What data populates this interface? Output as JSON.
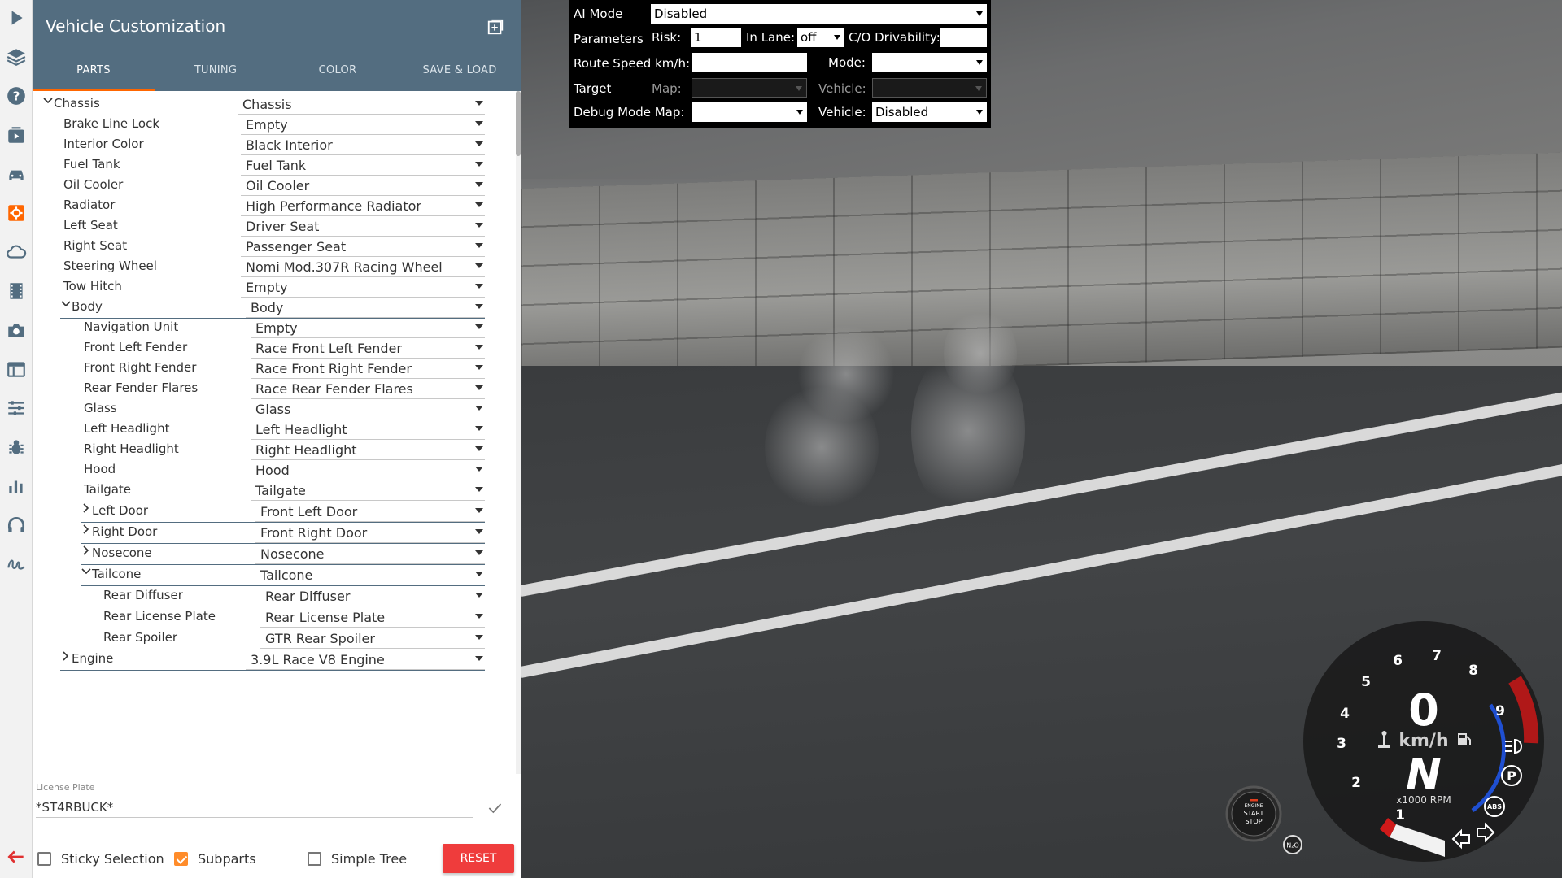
{
  "rail": {
    "icons": [
      "play-icon",
      "layers-icon",
      "help-icon",
      "media-icon",
      "car-icon",
      "gear-active-icon",
      "cloud-icon",
      "film-icon",
      "camera-icon",
      "ui-icon",
      "sliders-icon",
      "bug-icon",
      "chart-icon",
      "headphones-icon",
      "signature-icon"
    ],
    "back_icon": "back-arrow-icon",
    "accent": "#ff6600"
  },
  "panel": {
    "title": "Vehicle Customization",
    "header_color": "#536d80",
    "tabs": [
      {
        "label": "PARTS",
        "active": true
      },
      {
        "label": "TUNING",
        "active": false
      },
      {
        "label": "COLOR",
        "active": false
      },
      {
        "label": "SAVE & LOAD",
        "active": false
      }
    ],
    "tree": [
      {
        "label": "Chassis",
        "value": "Chassis",
        "depth": 0,
        "toggle": "open"
      },
      {
        "label": "Brake Line Lock",
        "value": "Empty",
        "depth": 1
      },
      {
        "label": "Interior Color",
        "value": "Black Interior",
        "depth": 1
      },
      {
        "label": "Fuel Tank",
        "value": "Fuel Tank",
        "depth": 1
      },
      {
        "label": "Oil Cooler",
        "value": "Oil Cooler",
        "depth": 1
      },
      {
        "label": "Radiator",
        "value": "High Performance Radiator",
        "depth": 1
      },
      {
        "label": "Left Seat",
        "value": "Driver Seat",
        "depth": 1
      },
      {
        "label": "Right Seat",
        "value": "Passenger Seat",
        "depth": 1
      },
      {
        "label": "Steering Wheel",
        "value": "Nomi Mod.307R Racing Wheel",
        "depth": 1
      },
      {
        "label": "Tow Hitch",
        "value": "Empty",
        "depth": 1
      },
      {
        "label": "Body",
        "value": "Body",
        "depth": 1,
        "toggle": "open"
      },
      {
        "label": "Navigation Unit",
        "value": "Empty",
        "depth": 2
      },
      {
        "label": "Front Left Fender",
        "value": "Race Front Left Fender",
        "depth": 2
      },
      {
        "label": "Front Right Fender",
        "value": "Race Front Right Fender",
        "depth": 2
      },
      {
        "label": "Rear Fender Flares",
        "value": "Race Rear Fender Flares",
        "depth": 2
      },
      {
        "label": "Glass",
        "value": "Glass",
        "depth": 2
      },
      {
        "label": "Left Headlight",
        "value": "Left Headlight",
        "depth": 2
      },
      {
        "label": "Right Headlight",
        "value": "Right Headlight",
        "depth": 2
      },
      {
        "label": "Hood",
        "value": "Hood",
        "depth": 2
      },
      {
        "label": "Tailgate",
        "value": "Tailgate",
        "depth": 2
      },
      {
        "label": "Left Door",
        "value": "Front Left Door",
        "depth": 2,
        "toggle": "closed"
      },
      {
        "label": "Right Door",
        "value": "Front Right Door",
        "depth": 2,
        "toggle": "closed"
      },
      {
        "label": "Nosecone",
        "value": "Nosecone",
        "depth": 2,
        "toggle": "closed"
      },
      {
        "label": "Tailcone",
        "value": "Tailcone",
        "depth": 2,
        "toggle": "open"
      },
      {
        "label": "Rear Diffuser",
        "value": "Rear Diffuser",
        "depth": 3
      },
      {
        "label": "Rear License Plate",
        "value": "Rear License Plate",
        "depth": 3
      },
      {
        "label": "Rear Spoiler",
        "value": "GTR Rear Spoiler",
        "depth": 3
      },
      {
        "label": "Engine",
        "value": "3.9L Race V8 Engine",
        "depth": 1,
        "toggle": "closed"
      }
    ],
    "license_plate": {
      "label": "License Plate",
      "value": "*ST4RBUCK*"
    },
    "footer": {
      "sticky_selection": {
        "label": "Sticky Selection",
        "checked": false
      },
      "subparts": {
        "label": "Subparts",
        "checked": true
      },
      "simple_tree": {
        "label": "Simple Tree",
        "checked": false
      },
      "reset_label": "RESET",
      "reset_color": "#ef3c3c"
    }
  },
  "ai": {
    "mode_label": "AI Mode",
    "mode_value": "Disabled",
    "params_label": "Parameters",
    "risk_label": "Risk:",
    "risk_value": "1",
    "inlane_label": "In Lane:",
    "inlane_value": "off",
    "drivability_label": "C/O Drivability:",
    "drivability_value": "",
    "route_speed_label": "Route Speed km/h:",
    "route_speed_value": "",
    "speed_mode_label": "Mode:",
    "speed_mode_value": "",
    "target_label": "Target",
    "map_label": "Map:",
    "vehicle_label": "Vehicle:",
    "debug_label": "Debug Mode Map:",
    "debug_map_value": "",
    "debug_vehicle_label": "Vehicle:",
    "debug_vehicle_value": "Disabled"
  },
  "dash": {
    "speed": "0",
    "speed_unit": "km/h",
    "gear": "N",
    "rpm_unit": "x1000 RPM",
    "rpm_ticks": [
      "1",
      "2",
      "3",
      "4",
      "5",
      "6",
      "7",
      "8",
      "9"
    ],
    "engine_button": [
      "ENGINE",
      "START",
      "STOP"
    ],
    "n2o": "N₂O",
    "abs": "ABS",
    "park": "P",
    "redline_color": "#b01818",
    "temp_arc_color": "#1f4fd1"
  }
}
